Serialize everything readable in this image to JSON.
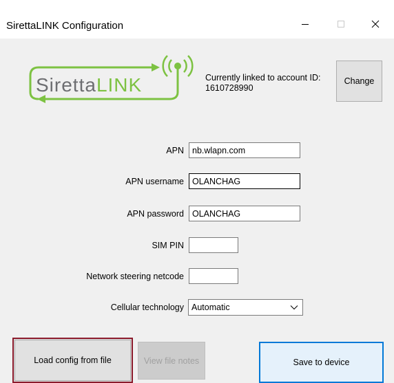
{
  "window": {
    "title": "SirettaLINK Configuration",
    "controls": [
      "minimize-icon",
      "maximize-icon",
      "close-icon"
    ]
  },
  "logo": {
    "text_part1": "Siretta",
    "text_part2": "LINK",
    "colors": {
      "green": "#7dc242",
      "gray": "#6d6e71"
    }
  },
  "account": {
    "label": "Currently linked to account ID:",
    "id": "1610728990",
    "change_label": "Change"
  },
  "form": {
    "apn": {
      "label": "APN",
      "value": "nb.wlapn.com"
    },
    "apn_username": {
      "label": "APN username",
      "value": "OLANCHAG"
    },
    "apn_password": {
      "label": "APN password",
      "value": "OLANCHAG"
    },
    "sim_pin": {
      "label": "SIM PIN",
      "value": ""
    },
    "netcode": {
      "label": "Network steering netcode",
      "value": ""
    },
    "cellular": {
      "label": "Cellular technology",
      "value": "Automatic"
    }
  },
  "buttons": {
    "load": "Load config from file",
    "view": "View file notes",
    "save": "Save to device"
  },
  "colors": {
    "load_highlight": "#8b1a2b",
    "save_focus": "#0078d7",
    "dialog_bg": "#f0f0f0"
  }
}
